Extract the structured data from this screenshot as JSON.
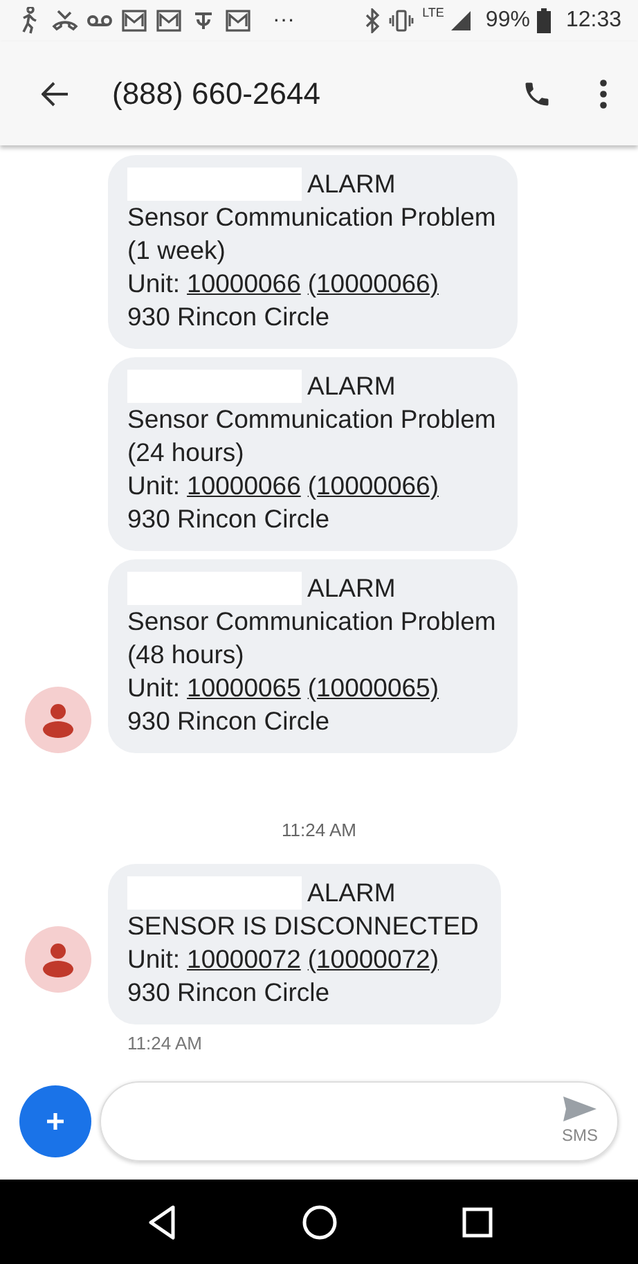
{
  "status_bar": {
    "ellipsis": "···",
    "network": "LTE",
    "battery": "99%",
    "time": "12:33"
  },
  "header": {
    "title": "(888) 660-2644"
  },
  "items": [
    {
      "kind": "message",
      "avatar": false,
      "redacted": true,
      "heading": "ALARM",
      "lines": [
        "Sensor Communication Problem",
        "(1 week)"
      ],
      "unit_label": "Unit:",
      "unit_links": [
        "10000066",
        "(10000066)"
      ],
      "address": "930 Rincon Circle"
    },
    {
      "kind": "message",
      "avatar": false,
      "redacted": true,
      "heading": "ALARM",
      "lines": [
        "Sensor Communication Problem",
        "(24 hours)"
      ],
      "unit_label": "Unit:",
      "unit_links": [
        "10000066",
        "(10000066)"
      ],
      "address": "930 Rincon Circle"
    },
    {
      "kind": "message",
      "avatar": true,
      "redacted": true,
      "heading": "ALARM",
      "lines": [
        "Sensor Communication Problem",
        "(48 hours)"
      ],
      "unit_label": "Unit:",
      "unit_links": [
        "10000065",
        "(10000065)"
      ],
      "address": "930 Rincon Circle"
    },
    {
      "kind": "divider",
      "text": "11:24 AM"
    },
    {
      "kind": "message",
      "avatar": true,
      "redacted": true,
      "heading": "ALARM",
      "lines": [
        "SENSOR IS DISCONNECTED"
      ],
      "unit_label": "Unit:",
      "unit_links": [
        "10000072",
        "(10000072)"
      ],
      "address": "930 Rincon Circle",
      "time": "11:24 AM"
    }
  ],
  "compose": {
    "send_label": "SMS"
  }
}
